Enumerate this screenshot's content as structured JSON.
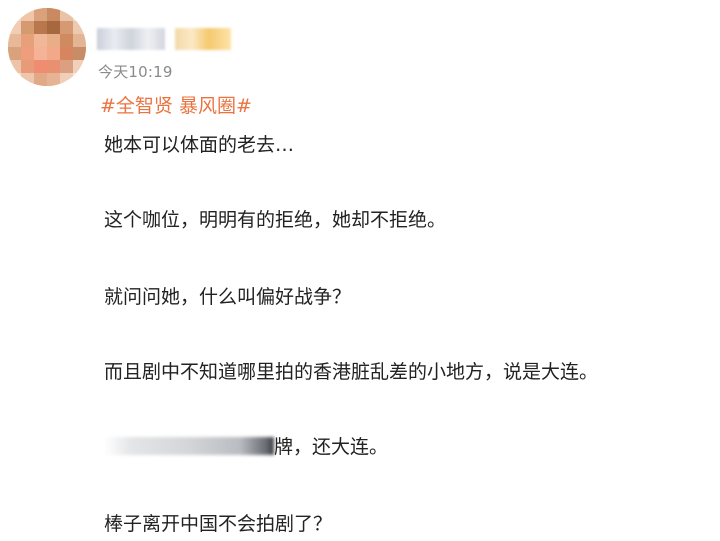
{
  "post": {
    "timestamp": "今天10:19",
    "topics": [
      "#全智贤",
      "暴风圈#"
    ],
    "lines": [
      "她本可以体面的老去…",
      "这个咖位，明明有的拒绝，她却不拒绝。",
      "就问问她，什么叫偏好战争？",
      "而且剧中不知道哪里拍的香港脏乱差的小地方，说是大连。",
      "牌，还大连。",
      "棒子离开中国不会拍剧了？"
    ]
  },
  "colors": {
    "topic": "#eb7340",
    "timestamp": "#8a8a8a",
    "text": "#222222"
  }
}
